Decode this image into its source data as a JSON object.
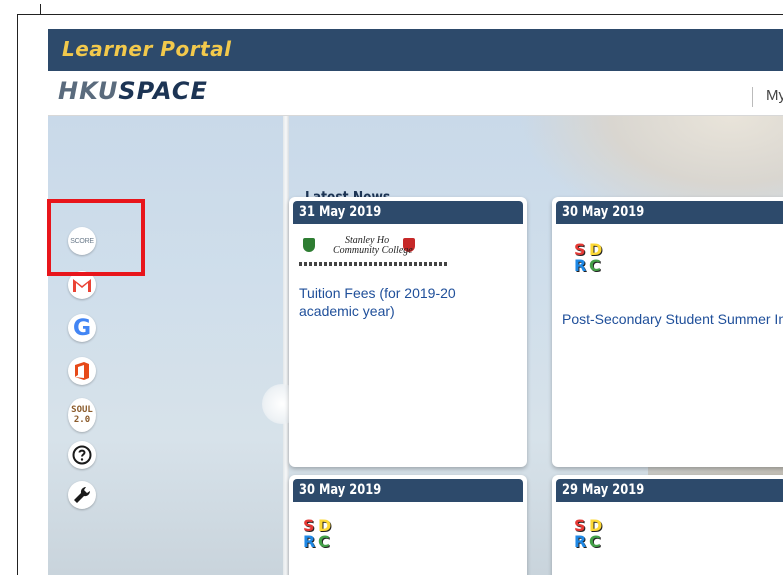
{
  "header": {
    "portal_title": "Learner Portal",
    "brand_hku": "HKU",
    "brand_space": "SPACE",
    "my_link": "My"
  },
  "sidebar": {
    "score_label": "SCORE",
    "soul_label_line1": "SOUL",
    "soul_label_line2": "2.0",
    "google_letter": "G",
    "icons": [
      "score-icon",
      "gmail-icon",
      "google-icon",
      "office-icon",
      "soul-icon",
      "help-icon",
      "wrench-icon"
    ]
  },
  "news": {
    "heading": "Latest News",
    "cards": [
      {
        "date": "31 May 2019",
        "title": "Tuition Fees (for 2019-20 academic year)",
        "logo_text_1": "Stanley Ho",
        "logo_text_2": "Community College"
      },
      {
        "date": "30 May 2019",
        "title": "Post-Secondary Student Summer Internship Programme - Transport Department (運輸署)"
      },
      {
        "date": "30 May 2019",
        "title": ""
      },
      {
        "date": "29 May 2019",
        "title": ""
      }
    ],
    "sdrc_letters": [
      "S",
      "D",
      "R",
      "C"
    ]
  },
  "colors": {
    "header_bg": "#2d4a6b",
    "portal_title": "#f2c94c",
    "highlight": "#e8151b",
    "link": "#1f4f9a"
  }
}
